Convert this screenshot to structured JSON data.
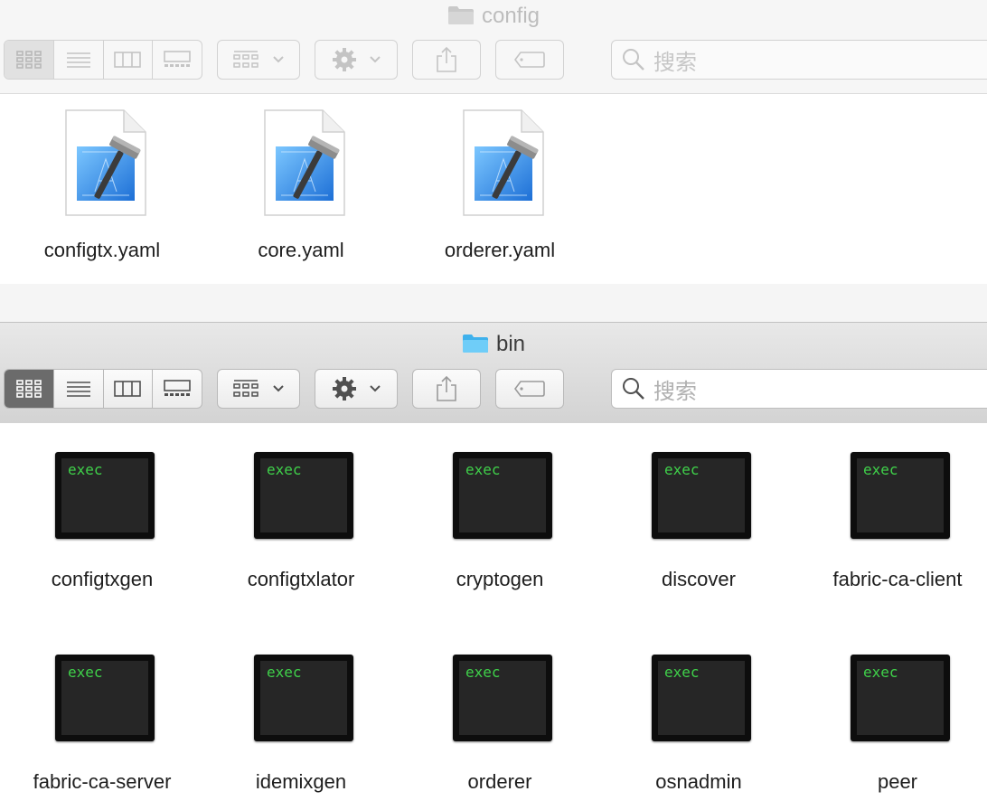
{
  "windows": {
    "config": {
      "title": "config",
      "search_placeholder": "搜索",
      "files": [
        {
          "name": "configtx.yaml",
          "icon": "xcode-document-icon"
        },
        {
          "name": "core.yaml",
          "icon": "xcode-document-icon"
        },
        {
          "name": "orderer.yaml",
          "icon": "xcode-document-icon"
        }
      ]
    },
    "bin": {
      "title": "bin",
      "search_placeholder": "搜索",
      "exec_badge": "exec",
      "files": [
        {
          "name": "configtxgen"
        },
        {
          "name": "configtxlator"
        },
        {
          "name": "cryptogen"
        },
        {
          "name": "discover"
        },
        {
          "name": "fabric-ca-client"
        },
        {
          "name": "fabric-ca-server"
        },
        {
          "name": "idemixgen"
        },
        {
          "name": "orderer"
        },
        {
          "name": "osnadmin"
        },
        {
          "name": "peer"
        }
      ]
    }
  },
  "toolbar": {
    "view_modes": [
      "icon-view",
      "list-view",
      "column-view",
      "gallery-view"
    ],
    "active_view": "icon-view",
    "buttons": [
      "group-by",
      "action-gear",
      "share",
      "tags"
    ]
  },
  "colors": {
    "folder_blue": "#5ac8fa",
    "exec_text_green": "#3fd14a",
    "inactive_title": "#bdbdbd",
    "active_title": "#3c3c3c"
  }
}
